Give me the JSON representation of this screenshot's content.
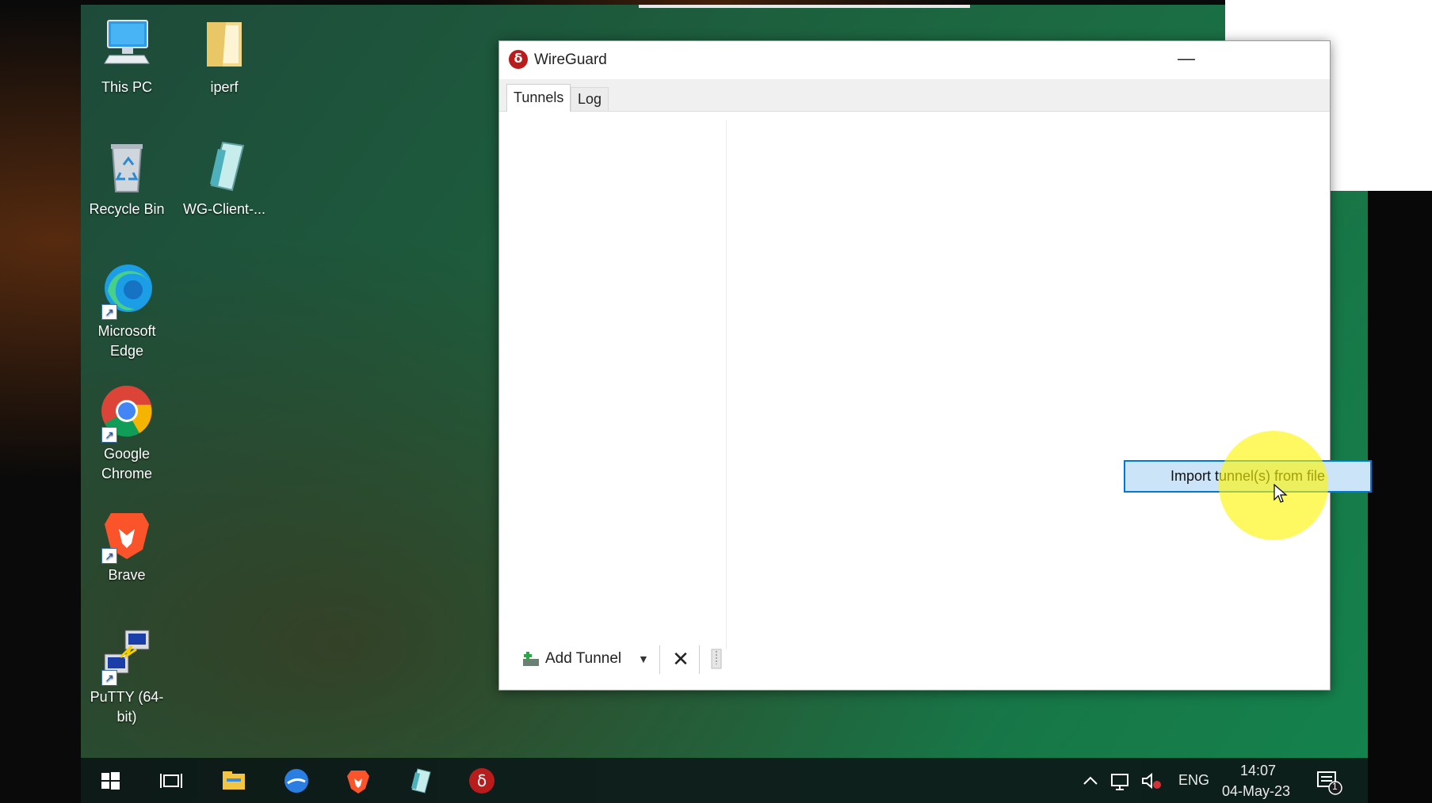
{
  "desktop": {
    "icons": [
      {
        "label": "This PC"
      },
      {
        "label": "iperf"
      },
      {
        "label": "Recycle Bin"
      },
      {
        "label": "WG-Client-..."
      },
      {
        "label": "Microsoft Edge"
      },
      {
        "label": "Google Chrome"
      },
      {
        "label": "Brave"
      },
      {
        "label": "PuTTY (64-bit)"
      }
    ]
  },
  "window": {
    "title": "WireGuard",
    "minimize": "—",
    "tabs": [
      {
        "label": "Tunnels"
      },
      {
        "label": "Log"
      }
    ],
    "main": {
      "import_button": "Import tunnel(s) from file"
    },
    "toolbar": {
      "add_tunnel": "Add Tunnel",
      "delete": "✕"
    }
  },
  "taskbar": {
    "language": "ENG",
    "time": "14:07",
    "date": "04-May-23",
    "notifications": "1"
  },
  "colors": {
    "accent": "#0078d7",
    "button_fill": "#cce4f7",
    "highlight": "#fff500",
    "wireguard_red": "#b81c1c"
  }
}
